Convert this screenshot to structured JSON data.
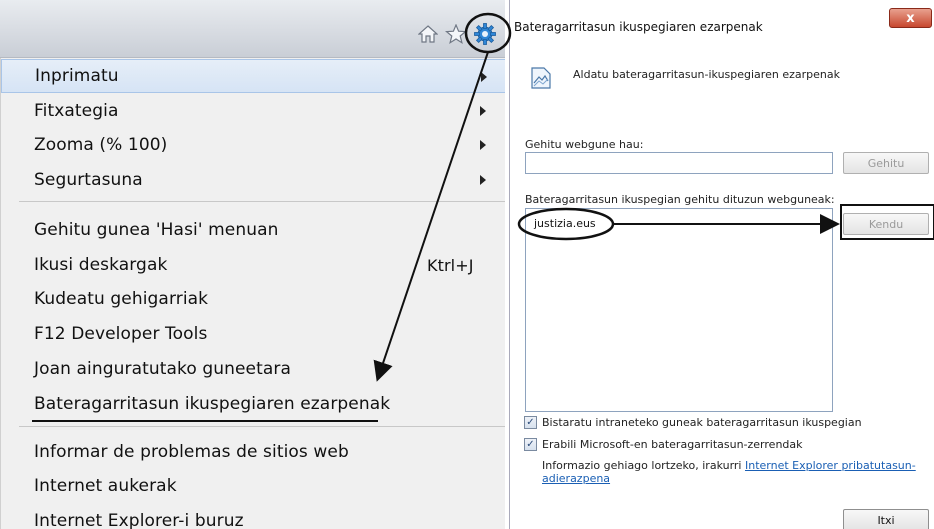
{
  "toolbar": {
    "home_icon": "home-icon",
    "star_icon": "star-icon",
    "gear_icon": "gear-icon"
  },
  "menu": {
    "items": [
      {
        "label": "Inprimatu",
        "submenu": true,
        "highlighted": true
      },
      {
        "label": "Fitxategia",
        "submenu": true
      },
      {
        "label": "Zooma (% 100)",
        "submenu": true
      },
      {
        "label": "Segurtasuna",
        "submenu": true
      },
      {
        "label": "Gehitu gunea 'Hasi' menuan"
      },
      {
        "label": "Ikusi deskargak",
        "shortcut": "Ktrl+J"
      },
      {
        "label": "Kudeatu gehigarriak"
      },
      {
        "label": "F12 Developer Tools"
      },
      {
        "label": "Joan ainguratutako guneetara"
      },
      {
        "label": "Bateragarritasun ikuspegiaren ezarpenak"
      },
      {
        "label": "Informar de problemas de sitios web"
      },
      {
        "label": "Internet aukerak"
      },
      {
        "label": "Internet Explorer-i buruz"
      }
    ]
  },
  "dialog": {
    "title": "Bateragarritasun ikuspegiaren ezarpenak",
    "close_glyph": "x",
    "header": "Aldatu bateragarritasun-ikuspegiaren ezarpenak",
    "add_label": "Gehitu webgune hau:",
    "add_input_value": "",
    "add_button": "Gehitu",
    "list_label": "Bateragarritasun ikuspegian gehitu dituzun webguneak:",
    "list_items": [
      "justizia.eus"
    ],
    "remove_button": "Kendu",
    "checkbox_intranet": {
      "label": "Bistaratu intraneteko guneak bateragarritasun ikuspegian",
      "checked": true
    },
    "checkbox_lists": {
      "label": "Erabili Microsoft-en bateragarritasun-zerrendak",
      "checked": true
    },
    "info_text": "Informazio gehiago lortzeko, irakurri",
    "info_link": "Internet Explorer pribatutasun-adierazpena",
    "close_button": "Itxi"
  },
  "colors": {
    "link": "#1a5fb4",
    "close_button_red": "#c7482f",
    "menu_highlight": "#d6e4f5",
    "annotation": "#111111"
  }
}
